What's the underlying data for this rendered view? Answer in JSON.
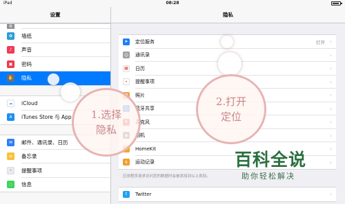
{
  "status": {
    "carrier": "iPad",
    "time": "08:28"
  },
  "left": {
    "title": "设置",
    "group1": [
      {
        "label": "",
        "icon": "settings-icon",
        "color": "#8e8e93",
        "cut": true
      },
      {
        "label": "墙纸",
        "icon": "wallpaper-icon",
        "color": "#2e9bd6"
      },
      {
        "label": "声音",
        "icon": "sound-icon",
        "color": "#f03b58"
      },
      {
        "label": "密码",
        "icon": "passcode-icon",
        "color": "#f0374d"
      },
      {
        "label": "隐私",
        "icon": "privacy-hand-icon",
        "color": "#6e6e73",
        "selected": true
      }
    ],
    "group2": [
      {
        "label": "iCloud",
        "icon": "icloud-icon",
        "color": "#ffffff"
      },
      {
        "label": "iTunes Store 与 App",
        "icon": "app-store-icon",
        "color": "#1b8ff0"
      }
    ],
    "group3": [
      {
        "label": "邮件、通讯录、日历",
        "icon": "mail-icon",
        "color": "#2d7ff4"
      },
      {
        "label": "备忘录",
        "icon": "notes-icon",
        "color": "#f5c33a"
      },
      {
        "label": "提醒事项",
        "icon": "reminders-icon",
        "color": "#e9e9ee"
      },
      {
        "label": "信息",
        "icon": "messages-icon",
        "color": "#3ed35a"
      }
    ]
  },
  "right": {
    "title": "隐私",
    "rows": [
      {
        "label": "定位服务",
        "value": "打开",
        "icon": "location-arrow-icon",
        "color": "#1f7ff2"
      },
      {
        "label": "通讯录",
        "value": "",
        "icon": "contacts-icon",
        "color": "#9f9f9f"
      },
      {
        "label": "日历",
        "value": "",
        "icon": "calendar-icon",
        "color": "#ffffff"
      },
      {
        "label": "提醒事项",
        "value": "",
        "icon": "reminders-icon",
        "color": "#ffffff"
      },
      {
        "label": "照片",
        "value": "",
        "icon": "photos-icon",
        "color": "#f2a23c"
      },
      {
        "label": "蓝牙共享",
        "value": "",
        "icon": "bluetooth-icon",
        "color": "#2f86f5"
      },
      {
        "label": "麦克风",
        "value": "",
        "icon": "microphone-icon",
        "color": "#e24a4a"
      },
      {
        "label": "相机",
        "value": "",
        "icon": "camera-icon",
        "color": "#6a6a70"
      },
      {
        "label": "HomeKit",
        "value": "",
        "icon": "homekit-icon",
        "color": "#f5a623"
      },
      {
        "label": "运动记录",
        "value": "",
        "icon": "motion-icon",
        "color": "#f29d2e"
      }
    ],
    "footnote": "应用程序请求访问您的数据时会被添加到以上类别。",
    "bottom_row": {
      "label": "Twitter",
      "icon": "twitter-icon",
      "color": "#1da1f2"
    }
  },
  "annotations": {
    "step1": "1.选择\n隐私",
    "step2": "2.打开\n定位"
  },
  "watermark": {
    "title": "百科全说",
    "subtitle": "助你轻松解决"
  },
  "colors": {
    "accent": "#007aff",
    "bubble_border": "#e6b4b4",
    "bubble_text": "#c9868a",
    "watermark": "#2b6f3e"
  }
}
